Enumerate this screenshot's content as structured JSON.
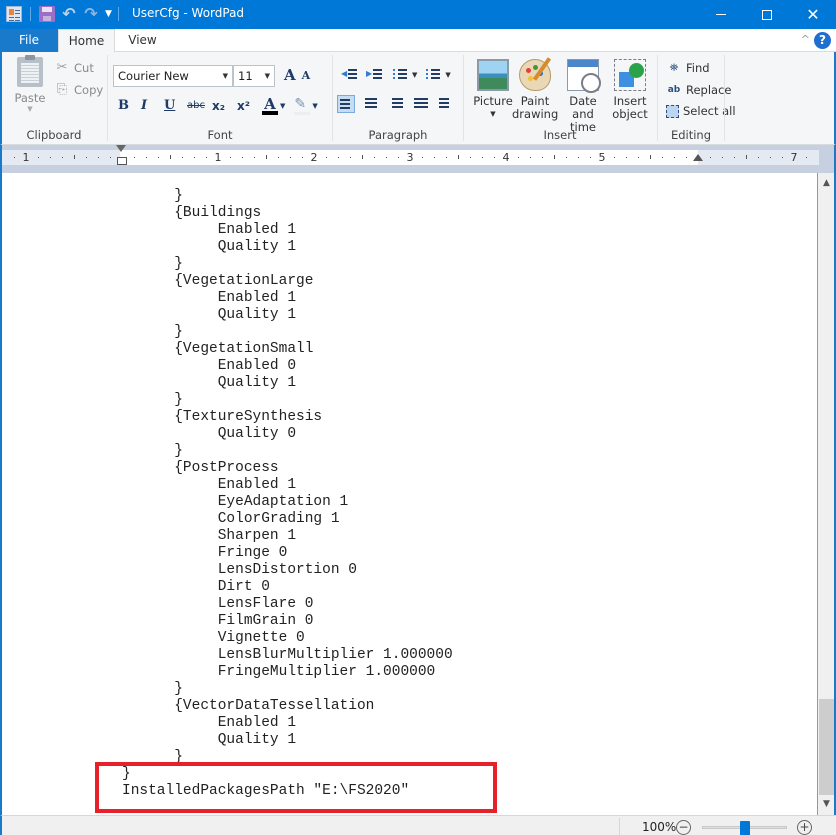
{
  "window": {
    "title": "UserCfg - WordPad",
    "minimize_glyph": "",
    "close_glyph": "✕"
  },
  "quick_access": {
    "undo_glyph": "↶",
    "redo_glyph": "↷",
    "more_glyph": "▼"
  },
  "tabs": [
    {
      "label": "File",
      "active": false
    },
    {
      "label": "Home",
      "active": true
    },
    {
      "label": "View",
      "active": false
    }
  ],
  "ribbon": {
    "collapse_glyph": "^",
    "help_glyph": "?",
    "clipboard": {
      "label": "Clipboard",
      "paste": "Paste",
      "cut": "Cut",
      "copy": "Copy",
      "cut_glyph": "✂",
      "copy_glyph": "⎘"
    },
    "font": {
      "label": "Font",
      "family": "Courier New",
      "size": "11",
      "grow_glyph": "A",
      "shrink_glyph": "A",
      "bold": "B",
      "italic": "I",
      "underline": "U",
      "strikethrough": "abc",
      "subscript": "x₂",
      "superscript": "x²",
      "font_color": "A",
      "highlight": "✎",
      "font_color_value": "#000000"
    },
    "paragraph": {
      "label": "Paragraph",
      "active_alignment": "left"
    },
    "insert": {
      "label": "Insert",
      "picture": "Picture",
      "paint_1": "Paint",
      "paint_2": "drawing",
      "date_1": "Date and",
      "date_2": "time",
      "object_1": "Insert",
      "object_2": "object"
    },
    "editing": {
      "label": "Editing",
      "find": "Find",
      "replace": "Replace",
      "select_all": "Select all",
      "find_glyph": "⛯",
      "replace_glyph": "ab"
    }
  },
  "ruler": {
    "unit": "inches",
    "labels": [
      {
        "text": "1",
        "inch": -1
      },
      {
        "text": "1",
        "inch": 1
      },
      {
        "text": "2",
        "inch": 2
      },
      {
        "text": "3",
        "inch": 3
      },
      {
        "text": "4",
        "inch": 4
      },
      {
        "text": "5",
        "inch": 5
      },
      {
        "text": "7",
        "inch": 7
      }
    ]
  },
  "document": {
    "lines": [
      "      }",
      "      {Buildings",
      "           Enabled 1",
      "           Quality 1",
      "      }",
      "      {VegetationLarge",
      "           Enabled 1",
      "           Quality 1",
      "      }",
      "      {VegetationSmall",
      "           Enabled 0",
      "           Quality 1",
      "      }",
      "      {TextureSynthesis",
      "           Quality 0",
      "      }",
      "      {PostProcess",
      "           Enabled 1",
      "           EyeAdaptation 1",
      "           ColorGrading 1",
      "           Sharpen 1",
      "           Fringe 0",
      "           LensDistortion 0",
      "           Dirt 0",
      "           LensFlare 0",
      "           FilmGrain 0",
      "           Vignette 0",
      "           LensBlurMultiplier 1.000000",
      "           FringeMultiplier 1.000000",
      "      }",
      "      {VectorDataTessellation",
      "           Enabled 1",
      "           Quality 1",
      "      }",
      "}",
      "InstalledPackagesPath \"E:\\FS2020\""
    ],
    "highlight_color": "#e8202a"
  },
  "scrollbar": {
    "up_glyph": "▲",
    "down_glyph": "▼"
  },
  "status": {
    "zoom": "100%",
    "zoom_out_glyph": "−",
    "zoom_in_glyph": "+"
  }
}
